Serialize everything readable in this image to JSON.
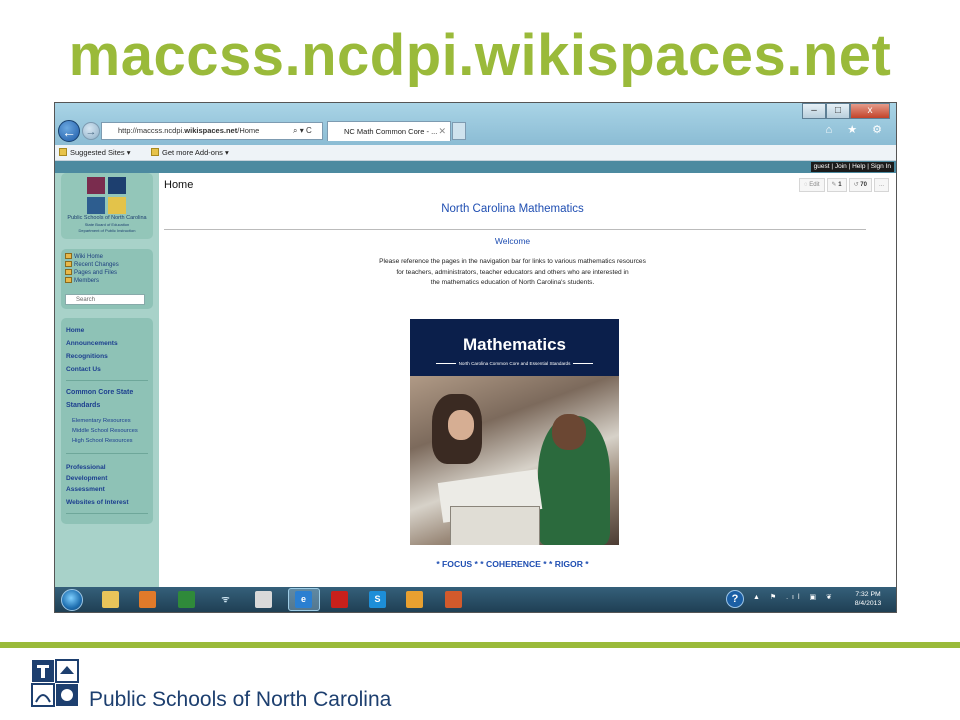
{
  "slide": {
    "title": "maccss.ncdpi.wikispaces.net",
    "footer_org": "Public Schools of North Carolina",
    "accent_color": "#9aba3a",
    "navy_color": "#1d3f6f"
  },
  "browser": {
    "window_buttons": [
      "–",
      "□",
      "x"
    ],
    "address_prefix": "http://maccss.ncdpi.",
    "address_domain": "wikispaces.net",
    "address_path": "/Home",
    "address_tools": "⌕ ▾ C",
    "tab_title": "NC Math Common Core - ...",
    "tab_close": "✕",
    "toolbar_icons": "⌂ ★ ⚙",
    "favorites": {
      "suggested_sites": "Suggested Sites ▾",
      "get_addons": "Get more Add-ons ▾"
    }
  },
  "wiki": {
    "user_links": "guest | Join | Help | Sign In",
    "logo": {
      "line1": "Public Schools of North Carolina",
      "line2": "State Board of Education",
      "line3": "Department of Public Instruction"
    },
    "tools": {
      "wiki_home": "Wiki Home",
      "recent_changes": "Recent Changes",
      "pages_files": "Pages and Files",
      "members": "Members",
      "search_placeholder": "Search"
    },
    "nav": {
      "home": "Home",
      "announcements": "Announcements",
      "recognitions": "Recognitions",
      "contact_us": "Contact Us",
      "standards_line1": "Common Core State",
      "standards_line2": "Standards",
      "elementary": "Elementary Resources",
      "middle": "Middle School Resources",
      "high": "High School Resources",
      "prof_dev_line1": "Professional",
      "prof_dev_line2": "Development",
      "assessment": "Assessment",
      "websites": "Websites of Interest"
    },
    "page": {
      "title": "Home",
      "edit": "Edit",
      "count1": "1",
      "count2": "70",
      "more": "...",
      "heading": "North Carolina Mathematics",
      "welcome": "Welcome",
      "para_line1": "Please reference the pages in the navigation bar for links to various mathematics resources",
      "para_line2": "for teachers, administrators, teacher educators and others who are interested in",
      "para_line3": "the mathematics education of North Carolina's students.",
      "cover_title": "Mathematics",
      "cover_subtitle": "North Carolina Common Core and Essential Standards",
      "focus_line": "* FOCUS * * COHERENCE * * RIGOR *"
    }
  },
  "taskbar": {
    "help_icon": "?",
    "tray": "▲ ⚑ .ıl ▣ ❦",
    "time": "7:32 PM",
    "date": "8/4/2013",
    "apps": [
      "skype",
      "S"
    ]
  }
}
